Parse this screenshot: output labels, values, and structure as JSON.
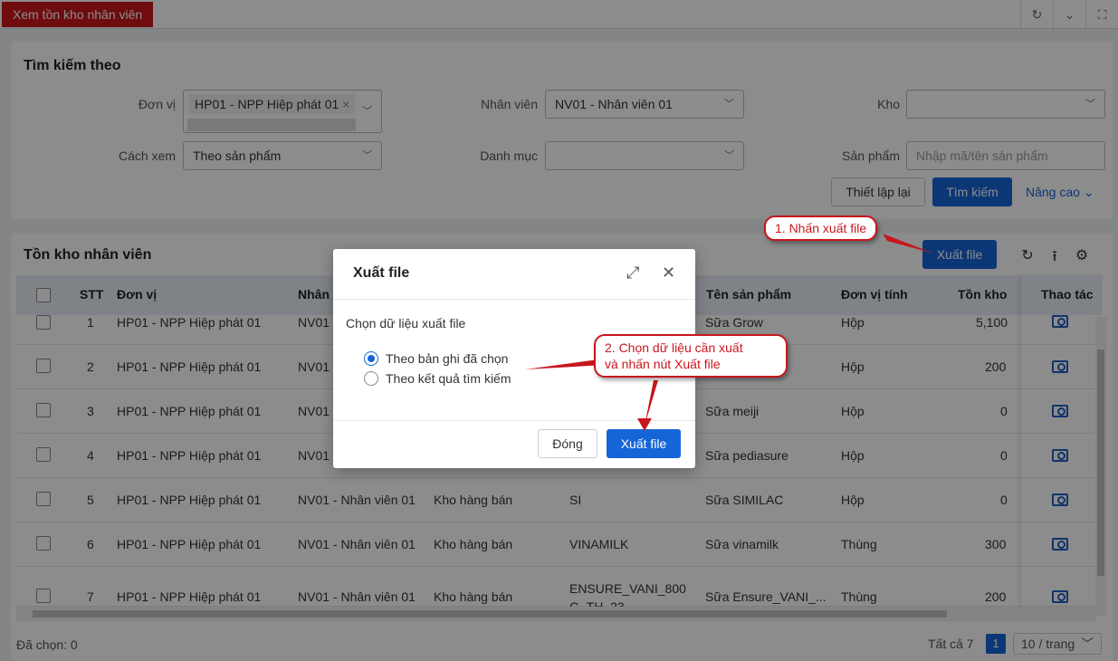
{
  "topbar": {
    "active_tab": "Xem tồn kho nhân viên",
    "icons": [
      "refresh-icon",
      "chevron-down-icon",
      "fullscreen-icon"
    ]
  },
  "search": {
    "title": "Tìm kiếm theo",
    "don_vi_label": "Đơn vị",
    "don_vi_tag": "HP01 - NPP Hiệp phát 01",
    "nhan_vien_label": "Nhân viên",
    "nhan_vien_value": "NV01 - Nhân viên 01",
    "kho_label": "Kho",
    "kho_value": "",
    "cach_xem_label": "Cách xem",
    "cach_xem_value": "Theo sản phẩm",
    "danh_muc_label": "Danh mục",
    "danh_muc_value": "",
    "san_pham_label": "Sản phẩm",
    "san_pham_placeholder": "Nhập mã/tên sản phẩm",
    "reset_button": "Thiết lập lại",
    "search_button": "Tìm kiếm",
    "advanced_link": "Nâng cao"
  },
  "table": {
    "title": "Tồn kho nhân viên",
    "export_button": "Xuất file",
    "columns": [
      "STT",
      "Đơn vị",
      "Nhân",
      "Tên sản phẩm",
      "Đơn vị tính",
      "Tồn kho",
      "Thao tác"
    ],
    "rows": [
      {
        "stt": "1",
        "don_vi": "HP01 - NPP Hiệp phát 01",
        "nhan_vien": "NV01",
        "kho": "",
        "ma": "",
        "ten": "Sữa Grow",
        "dvt": "Hộp",
        "ton": "5,100"
      },
      {
        "stt": "2",
        "don_vi": "HP01 - NPP Hiệp phát 01",
        "nhan_vien": "NV01",
        "kho": "",
        "ma": "",
        "ten": "",
        "dvt": "Hộp",
        "ton": "200"
      },
      {
        "stt": "3",
        "don_vi": "HP01 - NPP Hiệp phát 01",
        "nhan_vien": "NV01",
        "kho": "",
        "ma": "",
        "ten": "Sữa meiji",
        "dvt": "Hộp",
        "ton": "0"
      },
      {
        "stt": "4",
        "don_vi": "HP01 - NPP Hiệp phát 01",
        "nhan_vien": "NV01",
        "kho": "",
        "ma": "",
        "ten": "Sữa pediasure",
        "dvt": "Hộp",
        "ton": "0"
      },
      {
        "stt": "5",
        "don_vi": "HP01 - NPP Hiệp phát 01",
        "nhan_vien": "NV01 - Nhân viên 01",
        "kho": "Kho hàng bán",
        "ma": "SI",
        "ten": "Sữa SIMILAC",
        "dvt": "Hộp",
        "ton": "0"
      },
      {
        "stt": "6",
        "don_vi": "HP01 - NPP Hiệp phát 01",
        "nhan_vien": "NV01 - Nhân viên 01",
        "kho": "Kho hàng bán",
        "ma": "VINAMILK",
        "ten": "Sữa vinamilk",
        "dvt": "Thùng",
        "ton": "300"
      },
      {
        "stt": "7",
        "don_vi": "HP01 - NPP Hiệp phát 01",
        "nhan_vien": "NV01 - Nhân viên 01",
        "kho": "Kho hàng bán",
        "ma": "ENSURE_VANI_800\nG_TH_23",
        "ten": "Sữa Ensure_VANI_...",
        "dvt": "Thùng",
        "ton": "200"
      }
    ],
    "selected_count": "Đã chọn: 0",
    "total": "Tất cả 7",
    "current_page": "1",
    "page_size": "10 / trang"
  },
  "modal": {
    "title": "Xuất file",
    "section_label": "Chọn dữ liệu xuất file",
    "option_1": "Theo bản ghi đã chọn",
    "option_2": "Theo kết quả tìm kiếm",
    "close_button": "Đóng",
    "export_button": "Xuất file"
  },
  "callouts": {
    "step_1": "1. Nhấn xuất file",
    "step_2_line1": "2. Chọn dữ liệu cần xuất",
    "step_2_line2": "và nhấn nút Xuất file"
  },
  "colors": {
    "brand_red": "#c8161d",
    "primary_blue": "#1665d8"
  }
}
